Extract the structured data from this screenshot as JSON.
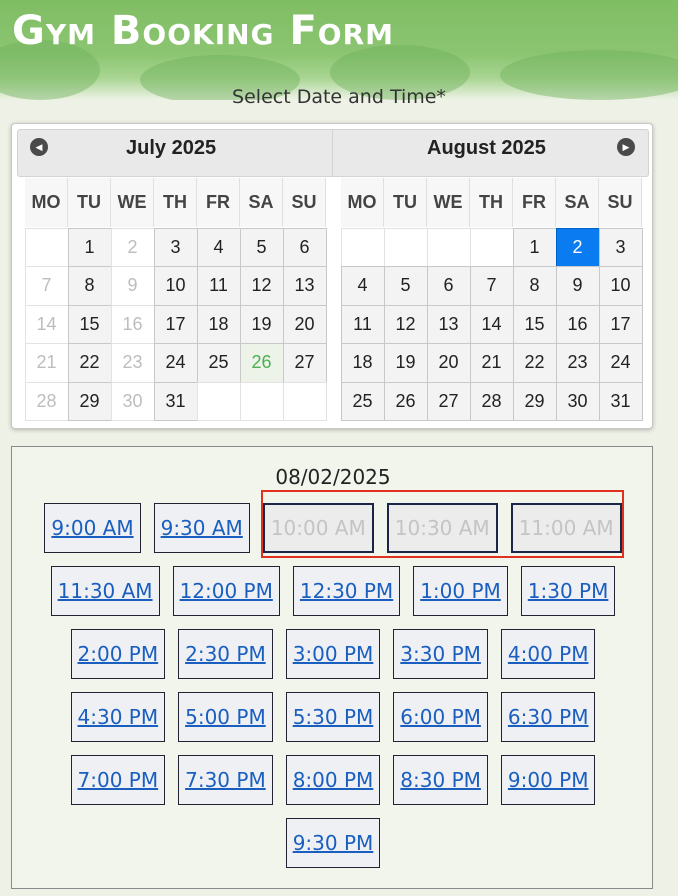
{
  "header": {
    "title": "Gym Booking Form"
  },
  "form": {
    "date_time_label": "Select Date and Time*"
  },
  "calendar": {
    "weekdays": [
      "MO",
      "TU",
      "WE",
      "TH",
      "FR",
      "SA",
      "SU"
    ],
    "months": [
      {
        "title": "July 2025",
        "days": [
          {
            "d": "",
            "s": "empty"
          },
          {
            "d": "1",
            "s": "available"
          },
          {
            "d": "2",
            "s": "disabled"
          },
          {
            "d": "3",
            "s": "available"
          },
          {
            "d": "4",
            "s": "available"
          },
          {
            "d": "5",
            "s": "available"
          },
          {
            "d": "6",
            "s": "available"
          },
          {
            "d": "7",
            "s": "disabled"
          },
          {
            "d": "8",
            "s": "available"
          },
          {
            "d": "9",
            "s": "disabled"
          },
          {
            "d": "10",
            "s": "available"
          },
          {
            "d": "11",
            "s": "available"
          },
          {
            "d": "12",
            "s": "available"
          },
          {
            "d": "13",
            "s": "available"
          },
          {
            "d": "14",
            "s": "disabled"
          },
          {
            "d": "15",
            "s": "available"
          },
          {
            "d": "16",
            "s": "disabled"
          },
          {
            "d": "17",
            "s": "available"
          },
          {
            "d": "18",
            "s": "available"
          },
          {
            "d": "19",
            "s": "available"
          },
          {
            "d": "20",
            "s": "available"
          },
          {
            "d": "21",
            "s": "disabled"
          },
          {
            "d": "22",
            "s": "available"
          },
          {
            "d": "23",
            "s": "disabled"
          },
          {
            "d": "24",
            "s": "available"
          },
          {
            "d": "25",
            "s": "available"
          },
          {
            "d": "26",
            "s": "today"
          },
          {
            "d": "27",
            "s": "available"
          },
          {
            "d": "28",
            "s": "disabled"
          },
          {
            "d": "29",
            "s": "available"
          },
          {
            "d": "30",
            "s": "disabled"
          },
          {
            "d": "31",
            "s": "available"
          },
          {
            "d": "",
            "s": "empty"
          },
          {
            "d": "",
            "s": "empty"
          },
          {
            "d": "",
            "s": "empty"
          }
        ]
      },
      {
        "title": "August 2025",
        "days": [
          {
            "d": "",
            "s": "empty"
          },
          {
            "d": "",
            "s": "empty"
          },
          {
            "d": "",
            "s": "empty"
          },
          {
            "d": "",
            "s": "empty"
          },
          {
            "d": "1",
            "s": "available"
          },
          {
            "d": "2",
            "s": "selected"
          },
          {
            "d": "3",
            "s": "available"
          },
          {
            "d": "4",
            "s": "available"
          },
          {
            "d": "5",
            "s": "available"
          },
          {
            "d": "6",
            "s": "available"
          },
          {
            "d": "7",
            "s": "available"
          },
          {
            "d": "8",
            "s": "available"
          },
          {
            "d": "9",
            "s": "available"
          },
          {
            "d": "10",
            "s": "available"
          },
          {
            "d": "11",
            "s": "available"
          },
          {
            "d": "12",
            "s": "available"
          },
          {
            "d": "13",
            "s": "available"
          },
          {
            "d": "14",
            "s": "available"
          },
          {
            "d": "15",
            "s": "available"
          },
          {
            "d": "16",
            "s": "available"
          },
          {
            "d": "17",
            "s": "available"
          },
          {
            "d": "18",
            "s": "available"
          },
          {
            "d": "19",
            "s": "available"
          },
          {
            "d": "20",
            "s": "available"
          },
          {
            "d": "21",
            "s": "available"
          },
          {
            "d": "22",
            "s": "available"
          },
          {
            "d": "23",
            "s": "available"
          },
          {
            "d": "24",
            "s": "available"
          },
          {
            "d": "25",
            "s": "available"
          },
          {
            "d": "26",
            "s": "available"
          },
          {
            "d": "27",
            "s": "available"
          },
          {
            "d": "28",
            "s": "available"
          },
          {
            "d": "29",
            "s": "available"
          },
          {
            "d": "30",
            "s": "available"
          },
          {
            "d": "31",
            "s": "available"
          }
        ]
      }
    ],
    "nav": {
      "prev_icon": "chevron-left-icon",
      "next_icon": "chevron-right-icon"
    }
  },
  "slots": {
    "selected_date": "08/02/2025",
    "rows": [
      [
        {
          "label": "9:00 AM",
          "enabled": true
        },
        {
          "label": "9:30 AM",
          "enabled": true
        },
        {
          "label": "10:00 AM",
          "enabled": false
        },
        {
          "label": "10:30 AM",
          "enabled": false
        },
        {
          "label": "11:00 AM",
          "enabled": false
        }
      ],
      [
        {
          "label": "11:30 AM",
          "enabled": true
        },
        {
          "label": "12:00 PM",
          "enabled": true
        },
        {
          "label": "12:30 PM",
          "enabled": true
        },
        {
          "label": "1:00 PM",
          "enabled": true
        },
        {
          "label": "1:30 PM",
          "enabled": true
        }
      ],
      [
        {
          "label": "2:00 PM",
          "enabled": true
        },
        {
          "label": "2:30 PM",
          "enabled": true
        },
        {
          "label": "3:00 PM",
          "enabled": true
        },
        {
          "label": "3:30 PM",
          "enabled": true
        },
        {
          "label": "4:00 PM",
          "enabled": true
        }
      ],
      [
        {
          "label": "4:30 PM",
          "enabled": true
        },
        {
          "label": "5:00 PM",
          "enabled": true
        },
        {
          "label": "5:30 PM",
          "enabled": true
        },
        {
          "label": "6:00 PM",
          "enabled": true
        },
        {
          "label": "6:30 PM",
          "enabled": true
        }
      ],
      [
        {
          "label": "7:00 PM",
          "enabled": true
        },
        {
          "label": "7:30 PM",
          "enabled": true
        },
        {
          "label": "8:00 PM",
          "enabled": true
        },
        {
          "label": "8:30 PM",
          "enabled": true
        },
        {
          "label": "9:00 PM",
          "enabled": true
        }
      ],
      [
        {
          "label": "9:30 PM",
          "enabled": true
        }
      ]
    ]
  },
  "colors": {
    "accent": "#0a7bf0",
    "highlight_border": "#e0311f",
    "link": "#1a5fbf",
    "today": "#4caf50"
  }
}
